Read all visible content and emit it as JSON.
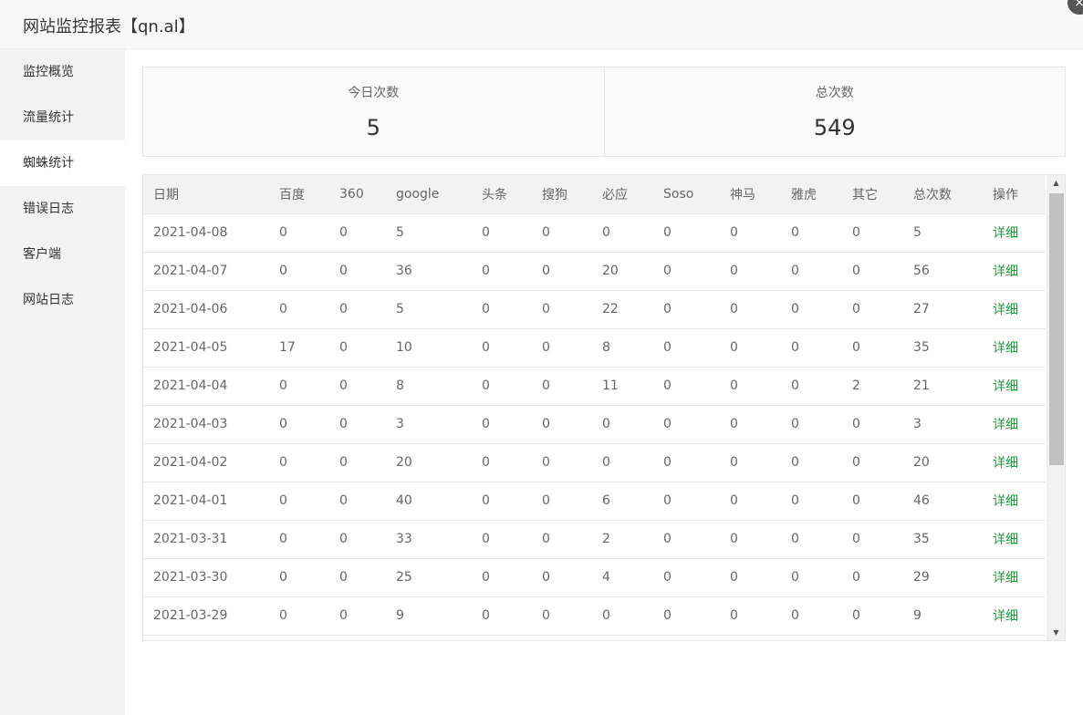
{
  "window": {
    "title": "网站监控报表【qn.al】",
    "close_icon": "×"
  },
  "sidebar": {
    "items": [
      {
        "label": "监控概览"
      },
      {
        "label": "流量统计"
      },
      {
        "label": "蜘蛛统计",
        "active": true
      },
      {
        "label": "错误日志"
      },
      {
        "label": "客户端"
      },
      {
        "label": "网站日志"
      }
    ]
  },
  "stats": {
    "today_label": "今日次数",
    "today_value": "5",
    "total_label": "总次数",
    "total_value": "549"
  },
  "table": {
    "headers": [
      "日期",
      "百度",
      "360",
      "google",
      "头条",
      "搜狗",
      "必应",
      "Soso",
      "神马",
      "雅虎",
      "其它",
      "总次数",
      "操作"
    ],
    "action_label": "详细",
    "rows": [
      [
        "2021-04-08",
        "0",
        "0",
        "5",
        "0",
        "0",
        "0",
        "0",
        "0",
        "0",
        "0",
        "5"
      ],
      [
        "2021-04-07",
        "0",
        "0",
        "36",
        "0",
        "0",
        "20",
        "0",
        "0",
        "0",
        "0",
        "56"
      ],
      [
        "2021-04-06",
        "0",
        "0",
        "5",
        "0",
        "0",
        "22",
        "0",
        "0",
        "0",
        "0",
        "27"
      ],
      [
        "2021-04-05",
        "17",
        "0",
        "10",
        "0",
        "0",
        "8",
        "0",
        "0",
        "0",
        "0",
        "35"
      ],
      [
        "2021-04-04",
        "0",
        "0",
        "8",
        "0",
        "0",
        "11",
        "0",
        "0",
        "0",
        "2",
        "21"
      ],
      [
        "2021-04-03",
        "0",
        "0",
        "3",
        "0",
        "0",
        "0",
        "0",
        "0",
        "0",
        "0",
        "3"
      ],
      [
        "2021-04-02",
        "0",
        "0",
        "20",
        "0",
        "0",
        "0",
        "0",
        "0",
        "0",
        "0",
        "20"
      ],
      [
        "2021-04-01",
        "0",
        "0",
        "40",
        "0",
        "0",
        "6",
        "0",
        "0",
        "0",
        "0",
        "46"
      ],
      [
        "2021-03-31",
        "0",
        "0",
        "33",
        "0",
        "0",
        "2",
        "0",
        "0",
        "0",
        "0",
        "35"
      ],
      [
        "2021-03-30",
        "0",
        "0",
        "25",
        "0",
        "0",
        "4",
        "0",
        "0",
        "0",
        "0",
        "29"
      ],
      [
        "2021-03-29",
        "0",
        "0",
        "9",
        "0",
        "0",
        "0",
        "0",
        "0",
        "0",
        "0",
        "9"
      ],
      [
        "",
        "",
        "",
        "",
        "",
        "",
        "",
        "",
        "",
        "",
        "",
        ""
      ]
    ]
  },
  "colors": {
    "link": "#1e9e3a",
    "sidebar_bg": "#f2f2f2",
    "header_bg": "#f2f2f2"
  },
  "icons": {
    "scroll_up": "scroll-up-arrow-icon",
    "scroll_down": "scroll-down-arrow-icon",
    "close": "close-icon"
  }
}
